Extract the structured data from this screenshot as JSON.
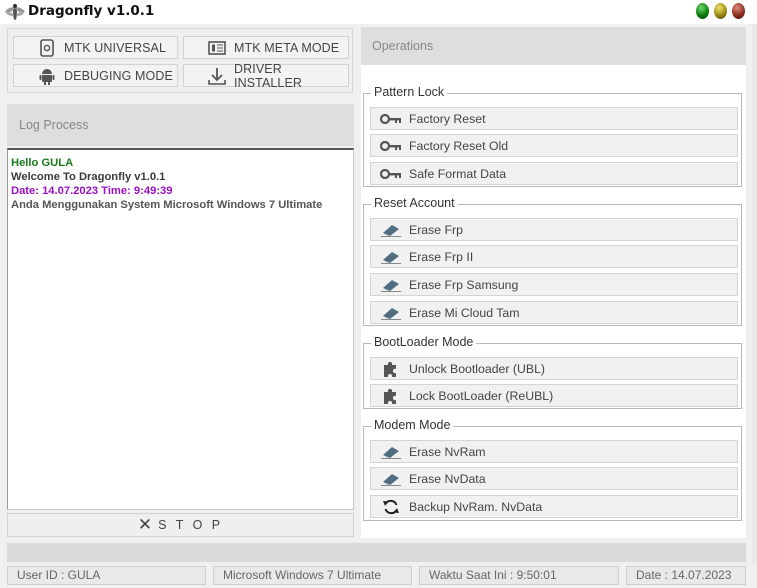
{
  "app": {
    "title": "Dragonfly  v1.0.1"
  },
  "modes": {
    "mtk_universal": "MTK  UNIVERSAL",
    "mtk_meta": "MTK  META MODE",
    "debuging": "DEBUGING MODE",
    "driver_installer": "DRIVER INSTALLER"
  },
  "log": {
    "header": "Log Process",
    "lines": [
      {
        "text": "Hello GULA",
        "color": "#1a7a1a"
      },
      {
        "text": "Welcome To Dragonfly  v1.0.1",
        "color": "#3a3a3a"
      },
      {
        "text": "Date: 14.07.2023  Time: 9:49:39",
        "color": "#9a10c0"
      },
      {
        "text": "Anda Menggunakan System Microsoft Windows 7 Ultimate",
        "color": "#555555"
      }
    ],
    "stop_label": "S T O P"
  },
  "operations": {
    "header": "Operations",
    "pattern_lock": {
      "title": "Pattern Lock",
      "buttons": [
        "Factory Reset",
        "Factory Reset Old",
        "Safe Format Data"
      ]
    },
    "reset_account": {
      "title": "Reset Account",
      "buttons": [
        "Erase Frp",
        "Erase Frp II",
        "Erase Frp Samsung",
        "Erase Mi Cloud Tam"
      ]
    },
    "bootloader": {
      "title": "BootLoader Mode",
      "buttons": [
        "Unlock Bootloader (UBL)",
        "Lock BootLoader (ReUBL)"
      ]
    },
    "modem": {
      "title": "Modem Mode",
      "buttons": [
        "Erase NvRam",
        "Erase NvData",
        "Backup NvRam. NvData"
      ]
    }
  },
  "status": {
    "user": "User ID : GULA",
    "os": "Microsoft Windows 7 Ultimate",
    "time": "Waktu Saat Ini : 9:50:01",
    "date": "Date : 14.07.2023"
  },
  "icons": {
    "logo": "dragonfly-logo-icon",
    "key": "key-icon",
    "eraser": "eraser-icon",
    "puzzle": "puzzle-icon",
    "sync": "sync-icon",
    "stop": "close-icon"
  },
  "colors": {
    "dot_green": "#0c7a0c",
    "dot_yellow": "#9a8a10",
    "dot_red": "#8a3020"
  }
}
